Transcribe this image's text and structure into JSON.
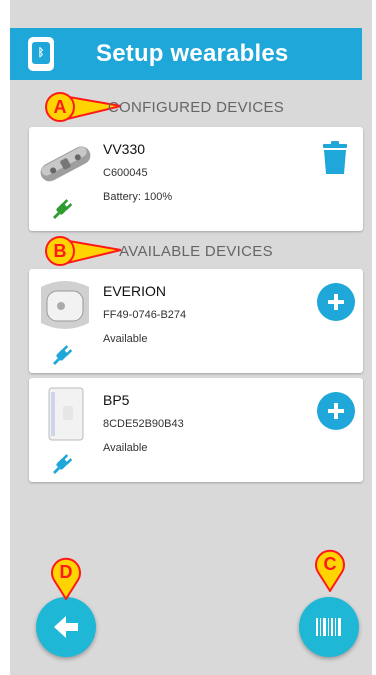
{
  "appbar": {
    "title": "Setup wearables",
    "icon": "bluetooth-phone-icon"
  },
  "sections": {
    "configured": {
      "label": "CONFIGURED DEVICES",
      "marker": "A"
    },
    "available": {
      "label": "AVAILABLE DEVICES",
      "marker": "B"
    }
  },
  "configured_devices": [
    {
      "name": "VV330",
      "id": "C600045",
      "status": "Battery: 100%"
    }
  ],
  "available_devices": [
    {
      "name": "EVERION",
      "id": "FF49-0746-B274",
      "status": "Available"
    },
    {
      "name": "BP5",
      "id": "8CDE52B90B43",
      "status": "Available"
    }
  ],
  "callouts": {
    "scan": "C",
    "back": "D"
  },
  "colors": {
    "accent": "#1ea7d8",
    "connected": "#2e9b2e",
    "marker_fill": "#ffd400",
    "marker_border": "#ff1a1a"
  }
}
